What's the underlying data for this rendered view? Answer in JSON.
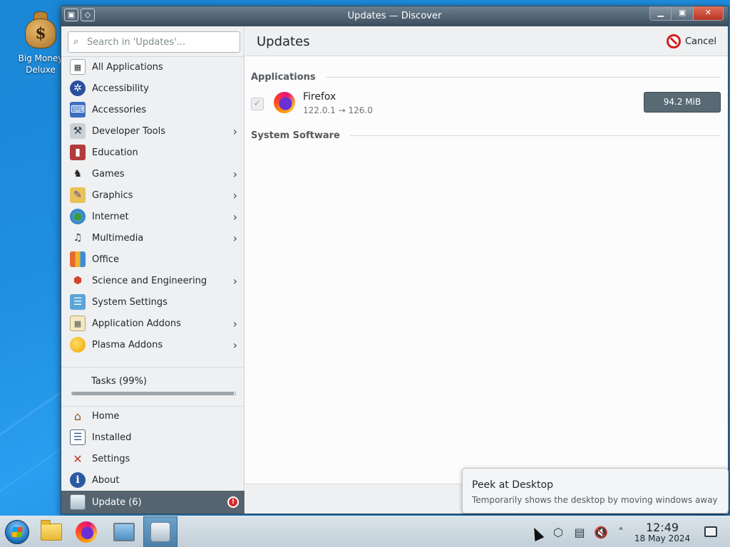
{
  "desktop": {
    "icon_label": "Big Money Deluxe"
  },
  "window": {
    "title": "Updates — Discover"
  },
  "sidebar": {
    "search_placeholder": "Search in 'Updates'...",
    "categories": [
      {
        "label": "All Applications",
        "icon": "grid-icon",
        "has_submenu": false
      },
      {
        "label": "Accessibility",
        "icon": "accessibility-icon",
        "has_submenu": false
      },
      {
        "label": "Accessories",
        "icon": "accessories-icon",
        "has_submenu": false
      },
      {
        "label": "Developer Tools",
        "icon": "developer-tools-icon",
        "has_submenu": true
      },
      {
        "label": "Education",
        "icon": "education-icon",
        "has_submenu": false
      },
      {
        "label": "Games",
        "icon": "games-icon",
        "has_submenu": true
      },
      {
        "label": "Graphics",
        "icon": "graphics-icon",
        "has_submenu": true
      },
      {
        "label": "Internet",
        "icon": "internet-icon",
        "has_submenu": true
      },
      {
        "label": "Multimedia",
        "icon": "multimedia-icon",
        "has_submenu": true
      },
      {
        "label": "Office",
        "icon": "office-icon",
        "has_submenu": false
      },
      {
        "label": "Science and Engineering",
        "icon": "science-icon",
        "has_submenu": true
      },
      {
        "label": "System Settings",
        "icon": "system-settings-icon",
        "has_submenu": false
      },
      {
        "label": "Application Addons",
        "icon": "addons-icon",
        "has_submenu": true
      },
      {
        "label": "Plasma Addons",
        "icon": "plasma-icon",
        "has_submenu": true
      }
    ],
    "tasks_label": "Tasks (99%)",
    "tasks_progress": 0.99,
    "nav": [
      {
        "label": "Home",
        "icon": "home-icon"
      },
      {
        "label": "Installed",
        "icon": "installed-icon"
      },
      {
        "label": "Settings",
        "icon": "settings-icon"
      },
      {
        "label": "About",
        "icon": "info-icon"
      }
    ],
    "update_label": "Update (6)"
  },
  "main": {
    "title": "Updates",
    "cancel_label": "Cancel",
    "sections": {
      "applications": "Applications",
      "system_software": "System Software"
    },
    "apps": [
      {
        "name": "Firefox",
        "version": "122.0.1 → 126.0",
        "size": "94.2 MiB",
        "checked": true
      }
    ]
  },
  "tooltip": {
    "title": "Peek at Desktop",
    "description": "Temporarily shows the desktop by moving windows away"
  },
  "taskbar": {
    "time": "12:49",
    "date": "18 May 2024"
  },
  "colors": {
    "accent": "#56646f",
    "desktop_bg": "#1f8fe0"
  }
}
